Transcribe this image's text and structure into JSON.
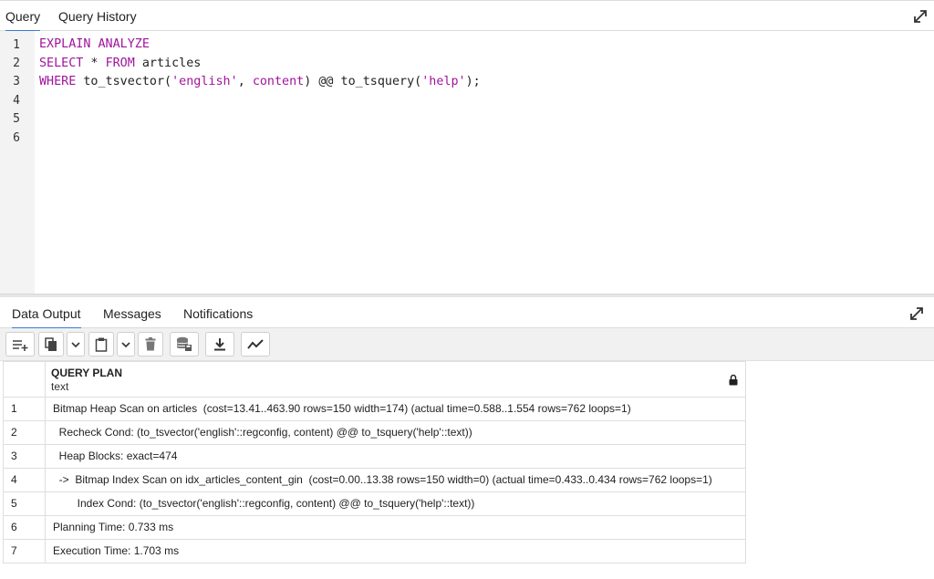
{
  "top_tabs": [
    {
      "label": "Query",
      "active": true
    },
    {
      "label": "Query History",
      "active": false
    }
  ],
  "editor": {
    "line_numbers": [
      "1",
      "2",
      "3",
      "4",
      "5",
      "6"
    ],
    "lines": {
      "l1": {
        "kw1": "EXPLAIN ANALYZE"
      },
      "l2": {
        "kw1": "SELECT",
        "t1": " * ",
        "kw2": "FROM",
        "t2": " articles"
      },
      "l3": {
        "kw1": "WHERE",
        "t1": " to_tsvector(",
        "s1": "'english'",
        "t2": ", ",
        "kw2": "content",
        "t3": ") @@ to_tsquery(",
        "s2": "'help'",
        "t4": ");"
      }
    }
  },
  "output_tabs": [
    {
      "label": "Data Output",
      "active": true
    },
    {
      "label": "Messages",
      "active": false
    },
    {
      "label": "Notifications",
      "active": false
    }
  ],
  "toolbar": {
    "buttons": [
      "add-row",
      "copy",
      "copy-dropdown",
      "paste",
      "paste-dropdown",
      "delete",
      "save-data",
      "download",
      "graph"
    ]
  },
  "grid": {
    "column": {
      "title": "QUERY PLAN",
      "type": "text"
    },
    "rows": [
      {
        "num": "1",
        "text": "Bitmap Heap Scan on articles  (cost=13.41..463.90 rows=150 width=174) (actual time=0.588..1.554 rows=762 loops=1)"
      },
      {
        "num": "2",
        "text": "  Recheck Cond: (to_tsvector('english'::regconfig, content) @@ to_tsquery('help'::text))"
      },
      {
        "num": "3",
        "text": "  Heap Blocks: exact=474"
      },
      {
        "num": "4",
        "text": "  ->  Bitmap Index Scan on idx_articles_content_gin  (cost=0.00..13.38 rows=150 width=0) (actual time=0.433..0.434 rows=762 loops=1)"
      },
      {
        "num": "5",
        "text": "        Index Cond: (to_tsvector('english'::regconfig, content) @@ to_tsquery('help'::text))"
      },
      {
        "num": "6",
        "text": "Planning Time: 0.733 ms"
      },
      {
        "num": "7",
        "text": "Execution Time: 1.703 ms"
      }
    ]
  },
  "colors": {
    "accent": "#3a7bd5",
    "keyword": "#a0149c"
  }
}
